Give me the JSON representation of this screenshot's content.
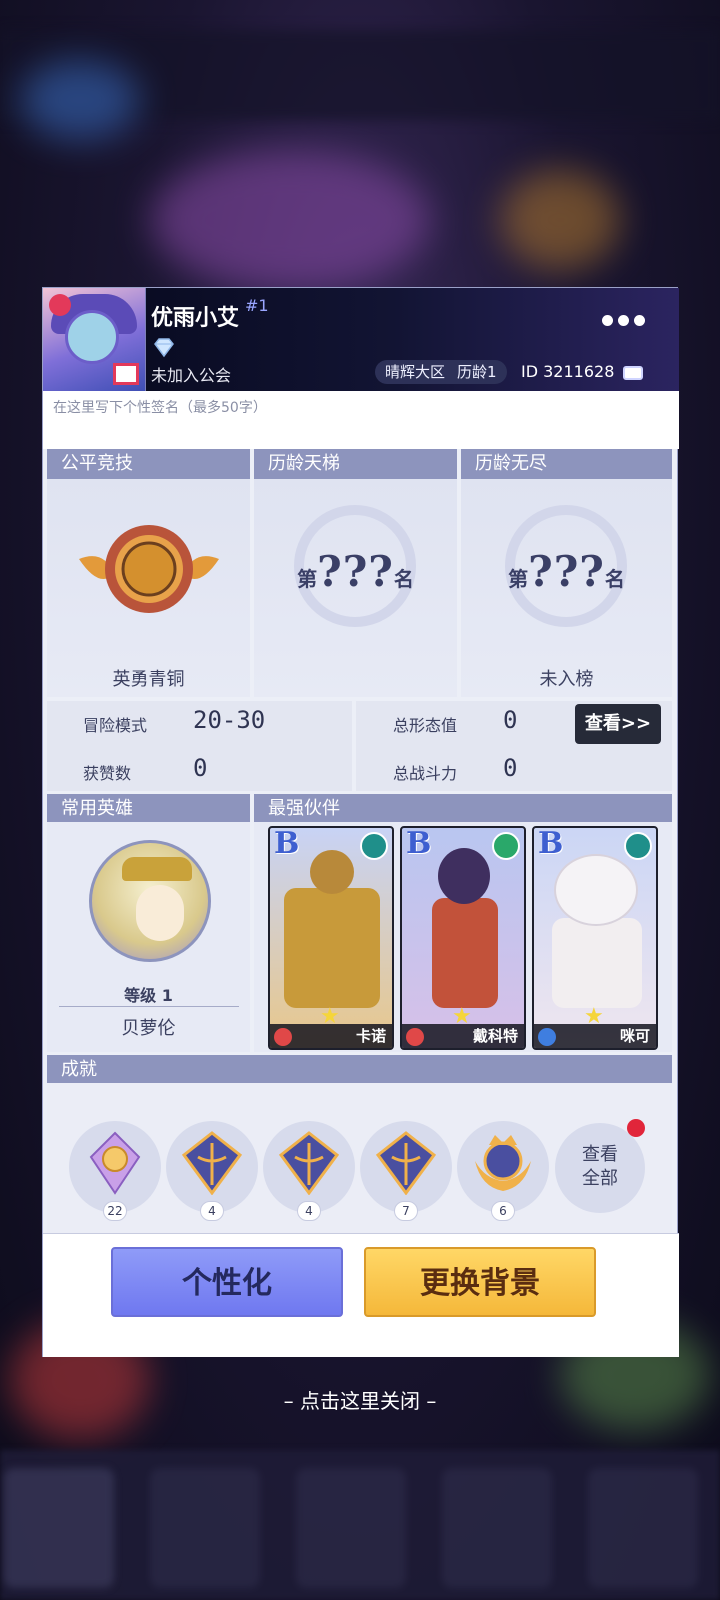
{
  "profile": {
    "name": "优雨小艾",
    "rank_tag": "#1",
    "guild": "未加入公会",
    "zone": "晴辉大区",
    "age": "历龄1",
    "uid": "ID 3211628"
  },
  "signature": {
    "placeholder": "在这里写下个性签名（最多50字）"
  },
  "ranks": [
    {
      "title": "公平竞技",
      "label": "英勇青铜"
    },
    {
      "title": "历龄天梯",
      "pre": "第",
      "value": "???",
      "post": "名",
      "label": ""
    },
    {
      "title": "历龄无尽",
      "pre": "第",
      "value": "???",
      "post": "名",
      "label": "未入榜"
    }
  ],
  "stats": {
    "adventure_label": "冒险模式",
    "adventure_value": "20-30",
    "likes_label": "获赞数",
    "likes_value": "0",
    "form_label": "总形态值",
    "form_value": "0",
    "power_label": "总战斗力",
    "power_value": "0",
    "view_label": "查看>>"
  },
  "heroes": {
    "common_title": "常用英雄",
    "partner_title": "最强伙伴",
    "common": {
      "level": "等级 1",
      "name": "贝萝伦"
    },
    "partners": [
      {
        "grade": "B",
        "name": "卡诺"
      },
      {
        "grade": "B",
        "name": "戴科特"
      },
      {
        "grade": "B",
        "name": "咪可"
      }
    ]
  },
  "achievements": {
    "title": "成就",
    "counts": [
      "22",
      "4",
      "4",
      "7",
      "6"
    ],
    "view_all_line1": "查看",
    "view_all_line2": "全部"
  },
  "buttons": {
    "personalize": "个性化",
    "change_bg": "更换背景"
  },
  "close_hint": "– 点击这里关闭 –",
  "colors": {
    "header_dark": "#06081c",
    "section_bar": "#8d94bd",
    "personalize_btn": "#7f88f4",
    "bg_btn": "#f7c84c",
    "badge_red": "#e1253a"
  }
}
